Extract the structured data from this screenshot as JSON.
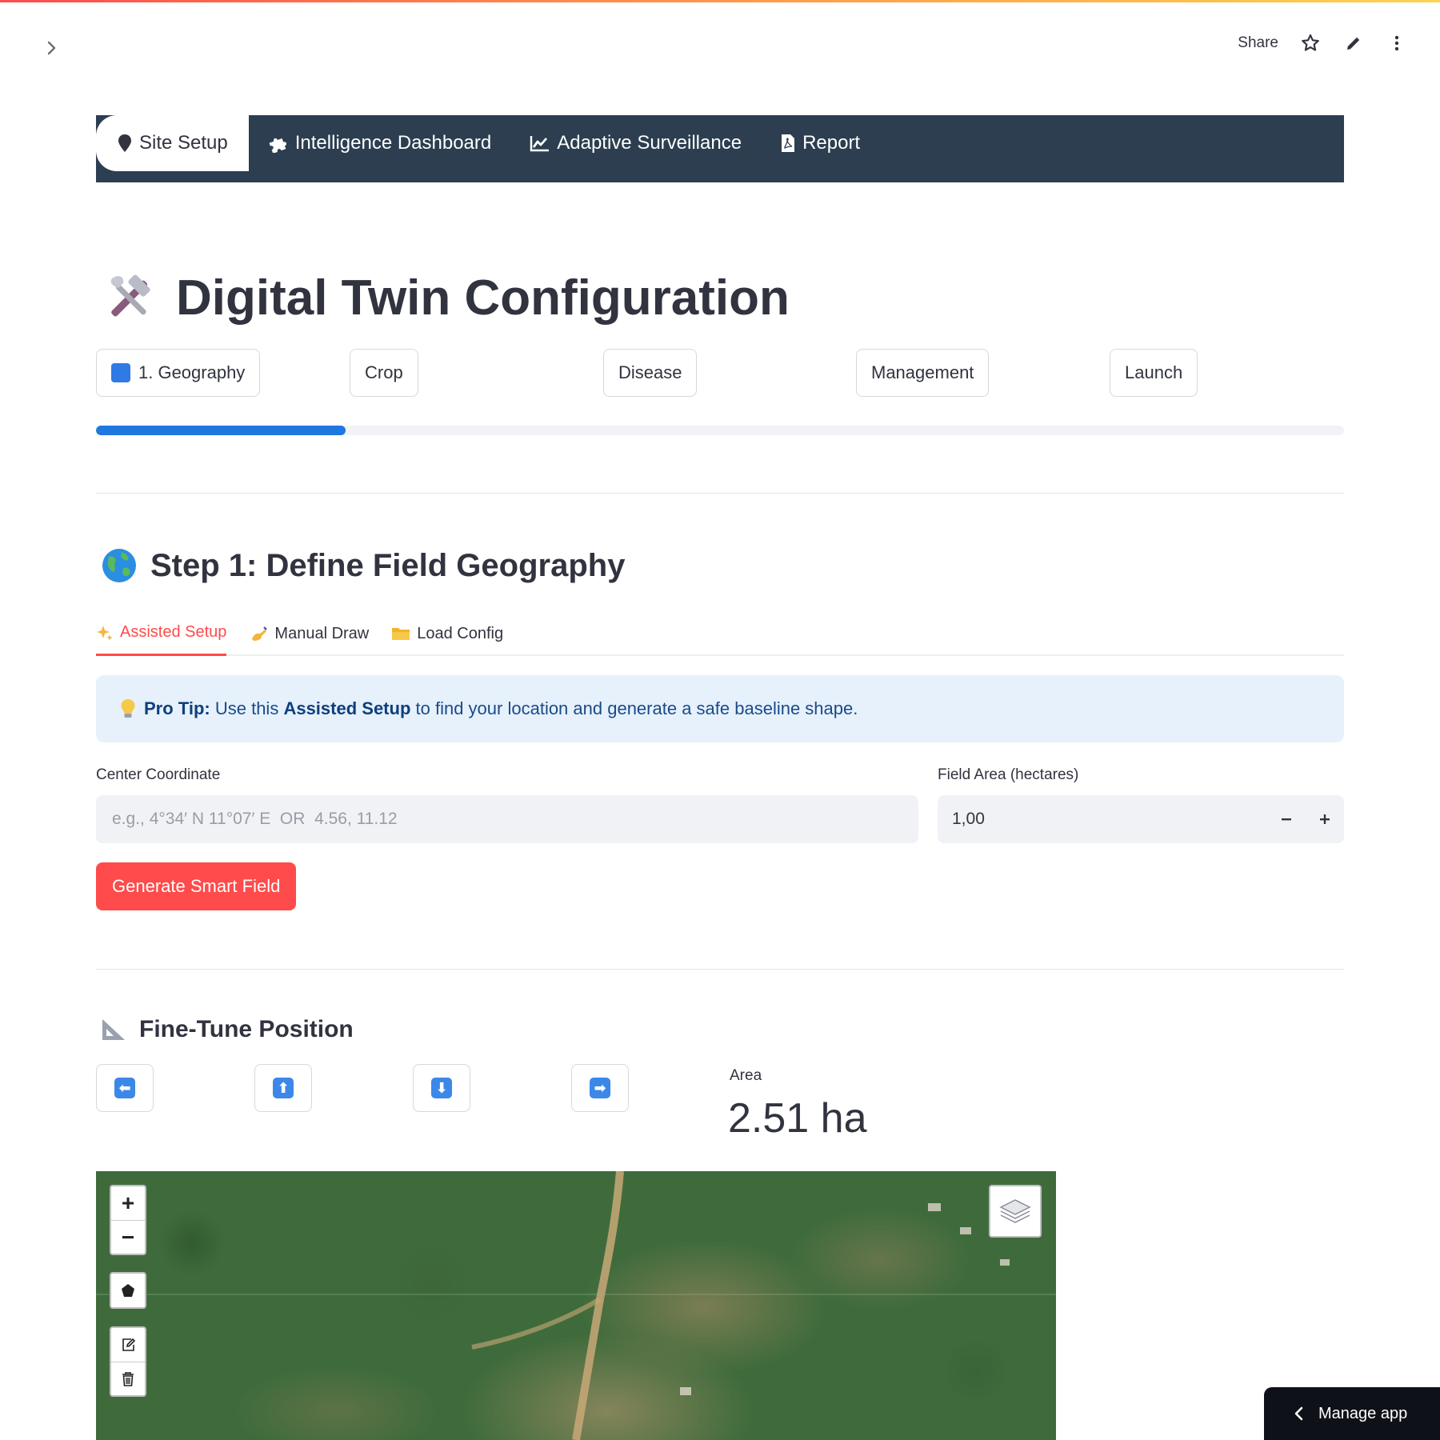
{
  "header": {
    "share_label": "Share",
    "icons": [
      "chevron-right-icon",
      "star-icon",
      "pencil-icon",
      "more-vertical-icon"
    ]
  },
  "nav": {
    "tabs": [
      {
        "label": "Site Setup",
        "icon": "map-pin-icon",
        "active": true
      },
      {
        "label": "Intelligence Dashboard",
        "icon": "puzzle-icon",
        "active": false
      },
      {
        "label": "Adaptive Surveillance",
        "icon": "chart-line-icon",
        "active": false
      },
      {
        "label": "Report",
        "icon": "file-pdf-icon",
        "active": false
      }
    ],
    "bar_color": "#2c3e50"
  },
  "page": {
    "title": "Digital Twin Configuration",
    "title_icon": "tools-icon"
  },
  "steps": {
    "items": [
      "1. Geography",
      "Crop",
      "Disease",
      "Management",
      "Launch"
    ],
    "progress_fraction": 0.2
  },
  "section1": {
    "title": "Step 1: Define Field Geography",
    "icon": "globe-icon",
    "tabs": [
      {
        "label": "Assisted Setup",
        "icon": "sparkles-icon",
        "active": true
      },
      {
        "label": "Manual Draw",
        "icon": "writing-hand-icon",
        "active": false
      },
      {
        "label": "Load Config",
        "icon": "folder-icon",
        "active": false
      }
    ],
    "tip": {
      "prefix": "Pro Tip:",
      "text_a": "Use this",
      "bold": "Assisted Setup",
      "text_b": "to find your location and generate a safe baseline shape."
    },
    "center_label": "Center Coordinate",
    "center_placeholder": "e.g., 4°34′ N 11°07′ E  OR  4.56, 11.12",
    "center_value": "",
    "area_label": "Field Area (hectares)",
    "area_value": "1,00",
    "generate_label": "Generate Smart Field"
  },
  "finetune": {
    "title": "Fine-Tune Position",
    "icon": "triangular-ruler-icon",
    "arrows": [
      {
        "name": "left",
        "glyph": "⬅"
      },
      {
        "name": "up",
        "glyph": "⬆"
      },
      {
        "name": "down",
        "glyph": "⬇"
      },
      {
        "name": "right",
        "glyph": "➡"
      }
    ],
    "metric_label": "Area",
    "metric_value": "2.51 ha"
  },
  "map": {
    "zoom_in": "+",
    "zoom_out": "−",
    "tools": [
      "polygon-draw-icon",
      "edit-layers-icon",
      "trash-icon"
    ],
    "layers_icon": "layers-icon"
  },
  "manage_app": {
    "label": "Manage app"
  },
  "colors": {
    "accent": "#ff4b4b",
    "progress": "#1f77e0",
    "info_bg": "#e6f1fb",
    "manage_bg": "#0e1117"
  }
}
